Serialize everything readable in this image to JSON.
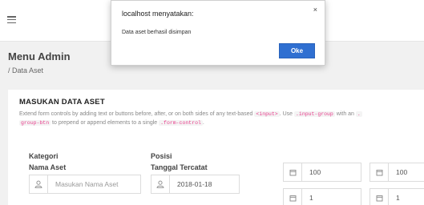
{
  "page": {
    "title": "Menu Admin",
    "breadcrumb": "/ Data Aset"
  },
  "card": {
    "title": "MASUKAN DATA ASET",
    "desc": {
      "t1": "Extend form controls by adding text or buttons before, after, or on both sides of any text-based ",
      "c1": "<input>",
      "t2": ". Use ",
      "c2": ".input-group",
      "t3": " with an ",
      "c3": ".",
      "c4": "group-btn",
      "t4": " to prepend or append elements to a single ",
      "c5": ".form-control",
      "t5": "."
    }
  },
  "form": {
    "kategori_label": "Kategori",
    "posisi_label": "Posisi",
    "nama_aset_label": "Nama Aset",
    "nama_aset_placeholder": "Masukan Nama Aset",
    "tanggal_label": "Tanggal Tercatat",
    "tanggal_value": "2018-01-18",
    "num1": "100",
    "num2": "100",
    "num3": "1",
    "num4": "1"
  },
  "dialog": {
    "title": "localhost menyatakan:",
    "message": "Data aset berhasil disimpan",
    "ok_label": "Oke",
    "close_symbol": "×"
  }
}
